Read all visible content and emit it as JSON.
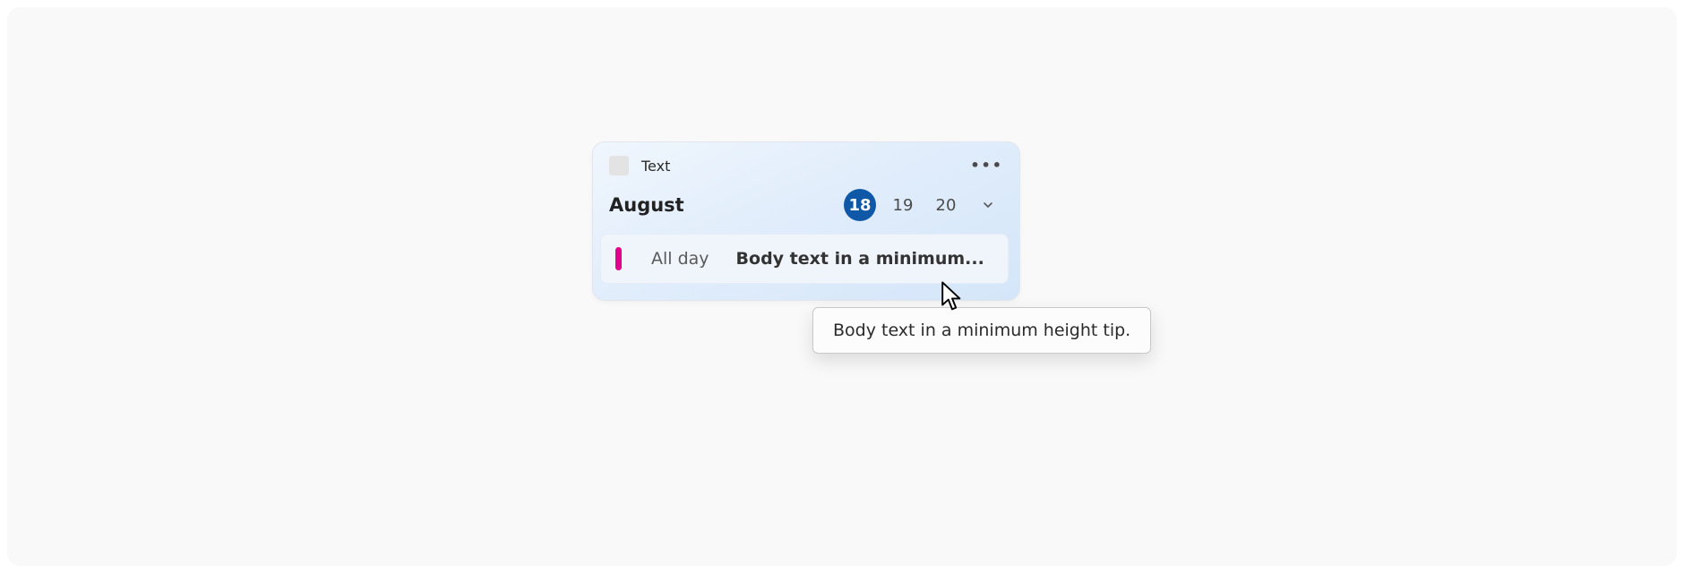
{
  "widget": {
    "app_title": "Text",
    "more_glyph": "•••"
  },
  "calendar": {
    "month_label": "August",
    "days": [
      {
        "num": "18",
        "selected": true
      },
      {
        "num": "19",
        "selected": false
      },
      {
        "num": "20",
        "selected": false
      }
    ]
  },
  "event": {
    "accent_color": "#e3008c",
    "time_label": "All day",
    "title_truncated": "Body text in a minimum..."
  },
  "tooltip": {
    "text": "Body text in a minimum height tip."
  }
}
